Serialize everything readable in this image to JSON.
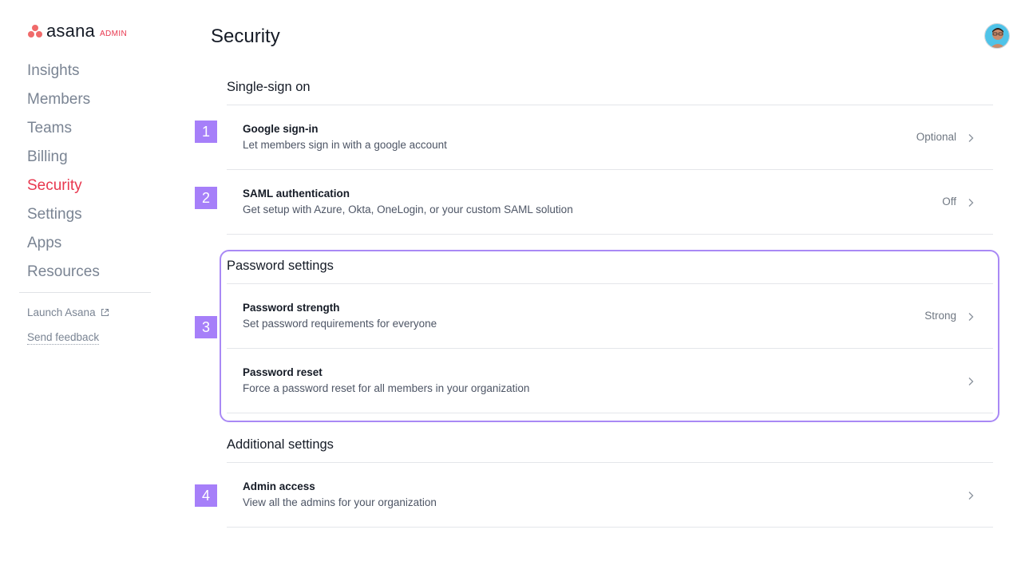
{
  "brand": {
    "wordmark": "asana",
    "suffix": "ADMIN",
    "brand_color": "#e8384f",
    "dot_color": "#f06a6a"
  },
  "sidebar": {
    "items": [
      {
        "label": "Insights",
        "active": false
      },
      {
        "label": "Members",
        "active": false
      },
      {
        "label": "Teams",
        "active": false
      },
      {
        "label": "Billing",
        "active": false
      },
      {
        "label": "Security",
        "active": true
      },
      {
        "label": "Settings",
        "active": false
      },
      {
        "label": "Apps",
        "active": false
      },
      {
        "label": "Resources",
        "active": false
      }
    ],
    "launch_label": "Launch Asana",
    "launch_icon": "external-link-icon",
    "feedback_label": "Send feedback"
  },
  "header": {
    "title": "Security",
    "avatar_icon": "user-avatar"
  },
  "sections": {
    "sso": {
      "title": "Single-sign on",
      "rows": [
        {
          "badge": "1",
          "title": "Google sign-in",
          "desc": "Let members sign in with a google account",
          "value": "Optional"
        },
        {
          "badge": "2",
          "title": "SAML authentication",
          "desc": "Get setup with Azure, Okta, OneLogin, or your custom SAML solution",
          "value": "Off"
        }
      ]
    },
    "password": {
      "title": "Password settings",
      "badge": "3",
      "rows": [
        {
          "title": "Password strength",
          "desc": "Set password requirements for everyone",
          "value": "Strong"
        },
        {
          "title": "Password reset",
          "desc": "Force a password reset for all members in your organization",
          "value": ""
        }
      ]
    },
    "additional": {
      "title": "Additional settings",
      "rows": [
        {
          "badge": "4",
          "title": "Admin access",
          "desc": "View all the admins for your organization",
          "value": ""
        }
      ]
    }
  },
  "colors": {
    "badge": "#a67ff9",
    "highlight": "#a989f5",
    "active_nav": "#e8384f"
  }
}
